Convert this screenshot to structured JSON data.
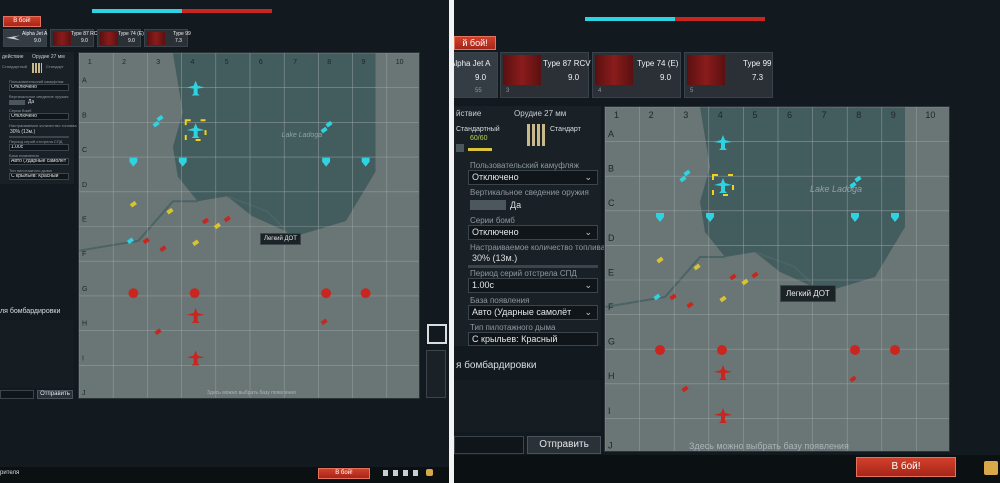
{
  "colors": {
    "ally": "#2fd2e0",
    "enemy": "#c8261f",
    "highlight": "#f2d21b",
    "target": "#d8c431",
    "accent_red": "#c23a26"
  },
  "left": {
    "battle_button": "В бой!",
    "vehicles": [
      {
        "name": "Alpha Jet A",
        "value": "9.0"
      },
      {
        "name": "Type 87 RCV",
        "value": "9.0"
      },
      {
        "name": "Type 74 (E)",
        "value": "9.0"
      },
      {
        "name": "Type 99",
        "value": "7.3"
      }
    ],
    "tabs": {
      "action": "действие",
      "gun": "Орудие 27 мм"
    },
    "ammo": {
      "standard_a": "Стандартный",
      "standard_b": "Стандарт",
      "pod_label": "Да"
    },
    "settings": [
      {
        "label": "Пользовательский камуфляж",
        "value": "Отключено"
      },
      {
        "label": "Вертикальное сведение оружия",
        "value": "Да"
      },
      {
        "label": "Серии бомб",
        "value": "Отключено"
      },
      {
        "label": "Настраиваемое количество топлива",
        "value": "30% (13м.)"
      },
      {
        "label": "Период серий отстрела СПД",
        "value": "1.00с"
      },
      {
        "label": "База появления",
        "value": "Авто (Ударные самолёт"
      },
      {
        "label": "Тип пилотажного дыма",
        "value": "С крыльев: Красный"
      }
    ],
    "bombing_title": "ля бомбардировки",
    "send_button": "Отправить",
    "spawn_hint": "Здесь можно выбрать базу появления",
    "tooltip": "Легкий ДОТ",
    "bottom_left": "рителя",
    "bottom_battle": "В бой!"
  },
  "right": {
    "battle_button": "й бой!",
    "vehicles": [
      {
        "name": "Alpha Jet A",
        "value": "9.0",
        "count": "55"
      },
      {
        "name": "Type 87 RCV",
        "value": "9.0",
        "count": "3"
      },
      {
        "name": "Type 74 (E)",
        "value": "9.0",
        "count": "4"
      },
      {
        "name": "Type 99",
        "value": "7.3",
        "count": "5"
      }
    ],
    "tabs": {
      "action": "йствие",
      "gun": "Орудие 27 мм"
    },
    "ammo": {
      "standard_a": "Стандартный",
      "count": "60/60",
      "standard_b": "Стандарт",
      "pod_label": "Да"
    },
    "settings": [
      {
        "label": "Пользовательский камуфляж",
        "value": "Отключено"
      },
      {
        "label": "Вертикальное сведение оружия",
        "value": "Да"
      },
      {
        "label": "Серии бомб",
        "value": "Отключено"
      },
      {
        "label": "Настраиваемое количество топлива",
        "value": "30% (13м.)"
      },
      {
        "label": "Период серий отстрела СПД",
        "value": "1.00с"
      },
      {
        "label": "База появления",
        "value": "Авто (Ударные самолёт"
      },
      {
        "label": "Тип пилотажного дыма",
        "value": "С крыльев: Красный"
      }
    ],
    "bombing_title": "я бомбардировки",
    "send_button": "Отправить",
    "spawn_hint": "Здесь можно выбрать базу появления",
    "tooltip": "Легкий ДОТ",
    "bottom_battle": "В бой!"
  },
  "map": {
    "columns": [
      "1",
      "2",
      "3",
      "4",
      "5",
      "6",
      "7",
      "8",
      "9",
      "10"
    ],
    "rows": [
      "A",
      "B",
      "C",
      "D",
      "E",
      "F",
      "G",
      "H",
      "I",
      "J"
    ],
    "lake_label": "Lake Ladoga"
  }
}
